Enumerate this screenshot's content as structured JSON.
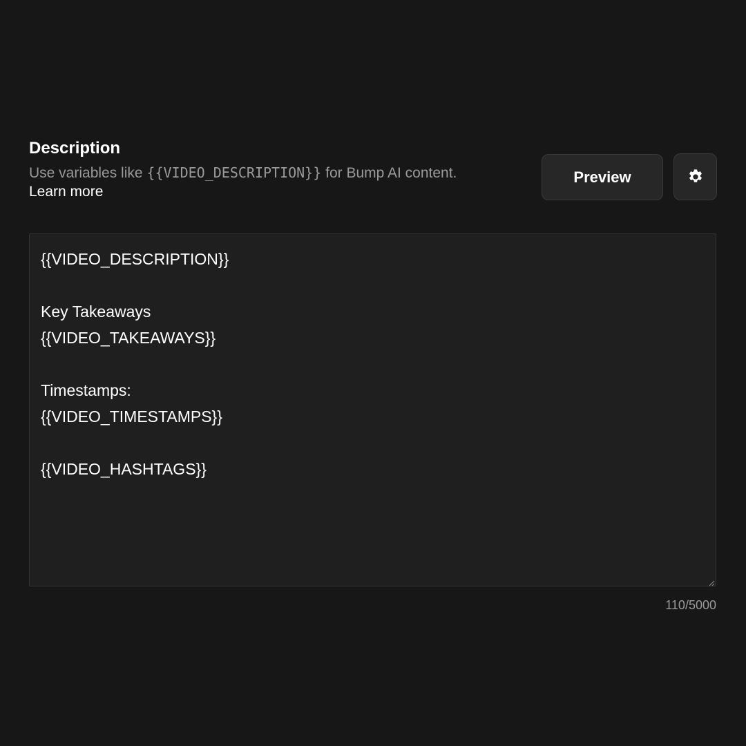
{
  "description_section": {
    "title": "Description",
    "help_prefix": "Use variables like ",
    "help_variable": "{{VIDEO_DESCRIPTION}}",
    "help_suffix": " for Bump AI content.",
    "learn_more_label": "Learn more"
  },
  "toolbar": {
    "preview_label": "Preview",
    "settings_icon": "gear-icon"
  },
  "editor": {
    "value": "{{VIDEO_DESCRIPTION}}\n\nKey Takeaways\n{{VIDEO_TAKEAWAYS}}\n\nTimestamps:\n{{VIDEO_TIMESTAMPS}}\n\n{{VIDEO_HASHTAGS}}",
    "char_count": "110/5000"
  },
  "colors": {
    "background": "#171717",
    "editor_background": "#1f1f1f",
    "button_background": "#272727",
    "muted_text": "#9a9a9a",
    "text": "#ffffff"
  }
}
